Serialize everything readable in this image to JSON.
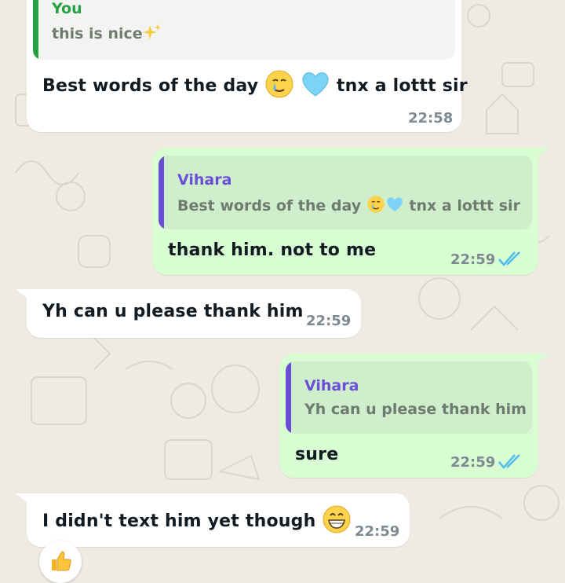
{
  "colors": {
    "background": "#efeae2",
    "incoming_bubble": "#ffffff",
    "outgoing_bubble": "#d9fdd3",
    "quote_you_accent": "#25a244",
    "quote_other_accent": "#6a4fd6",
    "read_ticks": "#53bdeb"
  },
  "messages": [
    {
      "quote_author": "You",
      "quote_text": "this is nice",
      "quote_emoji": "sparkles-icon",
      "text_a": "Best words of the day",
      "text_b": "tnx a lottt sir",
      "emojis": [
        "crying-smile-emoji-icon",
        "light-blue-heart-icon"
      ],
      "time": "22:58"
    },
    {
      "quote_author": "Vihara",
      "quote_text_a": "Best words of the day",
      "quote_text_b": "tnx a lottt sir",
      "text": "thank him. not to me",
      "time": "22:59",
      "status": "read-double-check-icon"
    },
    {
      "text": "Yh can u please thank him",
      "time": "22:59"
    },
    {
      "quote_author": "Vihara",
      "quote_text": "Yh can u please thank him",
      "text": "sure",
      "time": "22:59",
      "status": "read-double-check-icon"
    },
    {
      "text": "I didn't text him yet though",
      "emoji": "grinning-face-icon",
      "time": "22:59"
    }
  ],
  "reaction": {
    "emoji": "thumbs-up-icon"
  }
}
